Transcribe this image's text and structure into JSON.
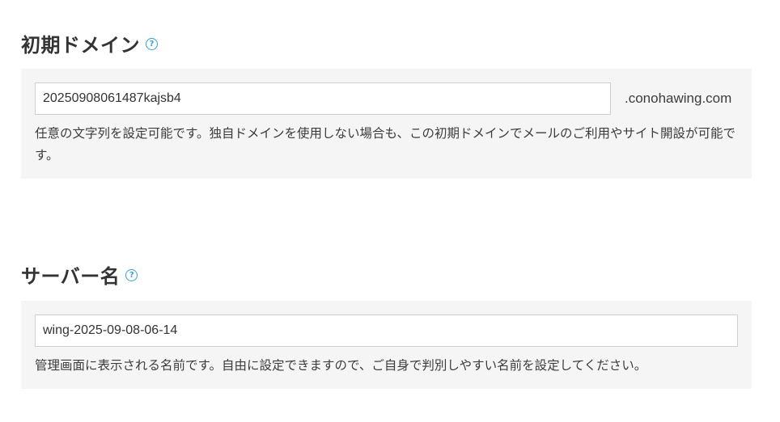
{
  "initial_domain": {
    "title": "初期ドメイン",
    "help_icon": "question-circle-icon",
    "input_value": "20250908061487kajsb4",
    "suffix": ".conohawing.com",
    "help_text": "任意の文字列を設定可能です。独自ドメインを使用しない場合も、この初期ドメインでメールのご利用やサイト開設が可能です。"
  },
  "server_name": {
    "title": "サーバー名",
    "help_icon": "question-circle-icon",
    "input_value": "wing-2025-09-08-06-14",
    "help_text": "管理画面に表示される名前です。自由に設定できますので、ご自身で判別しやすい名前を設定してください。"
  },
  "colors": {
    "panel_bg": "#f5f5f5",
    "help_icon": "#3a9fd5",
    "text": "#3c3c3c",
    "input_border": "#cfcfcf"
  }
}
